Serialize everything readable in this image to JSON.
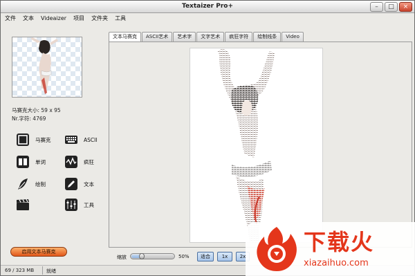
{
  "window": {
    "title": "Textaizer Pro+"
  },
  "menu": [
    "文件",
    "文本",
    "Videaizer",
    "项目",
    "文件夹",
    "工具"
  ],
  "left": {
    "mosaic_size": "马赛克大小: 59 x 95",
    "char_count": "Nr.字符: 4769",
    "modes": [
      {
        "label": "马赛克",
        "icon": "mosaic-icon"
      },
      {
        "label": "ASCII",
        "icon": "keyboard-icon"
      },
      {
        "label": "单词",
        "icon": "book-icon"
      },
      {
        "label": "疯狂",
        "icon": "waveform-icon"
      },
      {
        "label": "绘制",
        "icon": "feather-icon"
      },
      {
        "label": "文本",
        "icon": "pencil-icon"
      },
      {
        "label": "",
        "icon": "clapper-icon"
      },
      {
        "label": "工具",
        "icon": "sliders-icon"
      }
    ],
    "enable_button": "启用文本马赛克"
  },
  "tabs": [
    "文本马赛克",
    "ASCII艺术",
    "艺术字",
    "文字艺术",
    "疯狂字符",
    "绘制线条",
    "Video"
  ],
  "active_tab_index": 0,
  "zoom": {
    "label": "缩放",
    "value": "50%",
    "level": 0.25
  },
  "zoom_buttons": [
    "适合",
    "1x",
    "2x"
  ],
  "status": {
    "memory": "69 / 323 MB",
    "state": "就绪"
  },
  "watermark": {
    "text": "下载火",
    "url": "xiazaihuo.com"
  },
  "colors": {
    "accent_orange": "#e2571a",
    "watermark_red": "#e4361b",
    "tab_blue": "#a9c6ea"
  }
}
